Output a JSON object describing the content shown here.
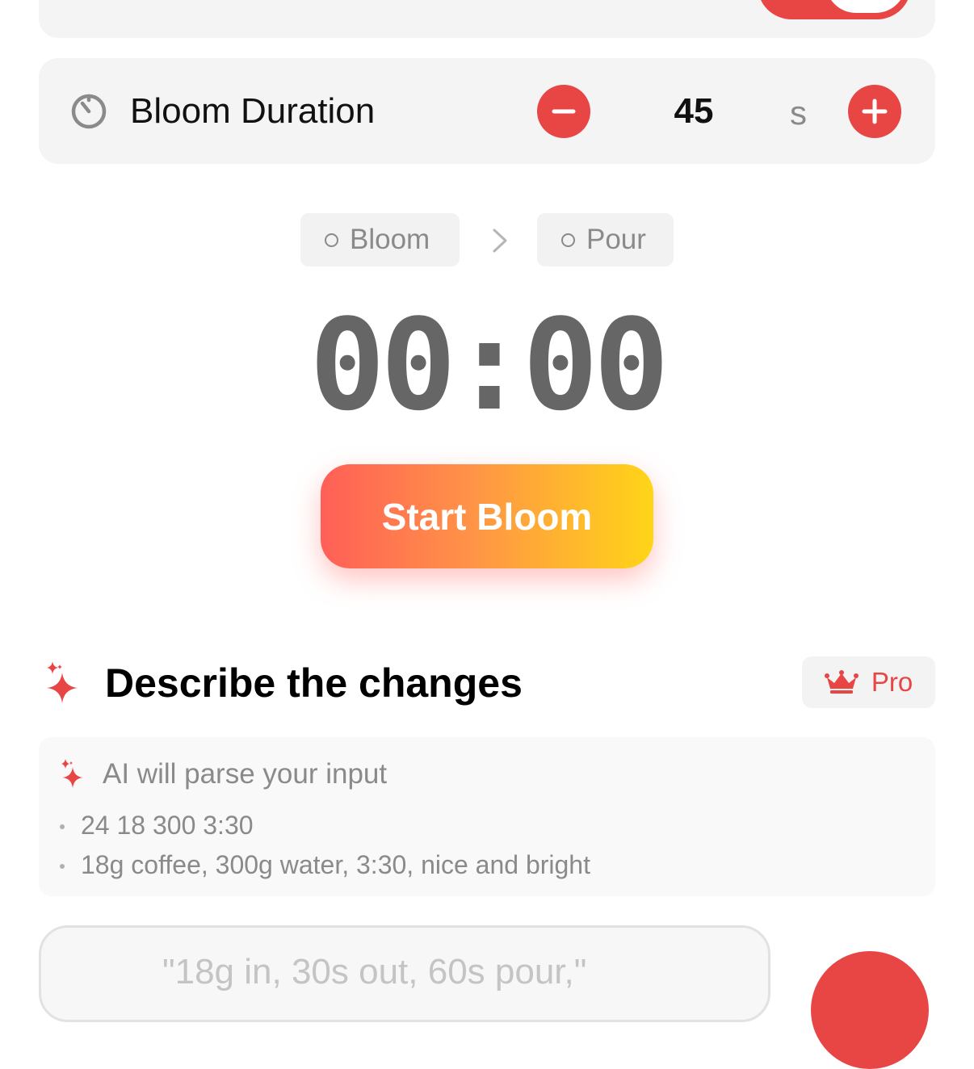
{
  "colors": {
    "accent": "#e84545",
    "muted": "#8a8a8a",
    "card": "#f4f4f4"
  },
  "bloom": {
    "label": "Bloom Duration",
    "icon": "timer-icon",
    "value": "45",
    "unit": "s"
  },
  "stages": [
    {
      "label": "Bloom"
    },
    {
      "label": "Pour"
    }
  ],
  "timer": {
    "display": "00:00"
  },
  "start_button": {
    "label": "Start Bloom"
  },
  "describe": {
    "title": "Describe the changes",
    "badge": "Pro",
    "badge_icon": "crown-icon"
  },
  "hint": {
    "title": "AI will parse your input",
    "examples": [
      "24 18 300 3:30",
      "18g coffee, 300g water, 3:30, nice and bright"
    ]
  },
  "input": {
    "placeholder": "\"18g in, 30s out, 60s pour,\""
  }
}
